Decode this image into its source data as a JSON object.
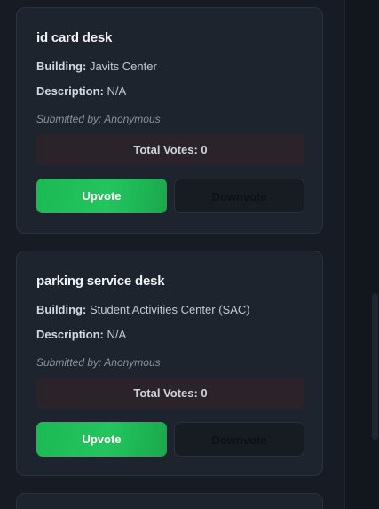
{
  "cards": [
    {
      "title": "id card desk",
      "building_label": "Building:",
      "building": "Javits Center",
      "description_label": "Description:",
      "description": "N/A",
      "submitted": "Submitted by: Anonymous",
      "votes": "Total Votes: 0",
      "upvote_label": "Upvote",
      "downvote_label": "Downvote"
    },
    {
      "title": "parking service desk",
      "building_label": "Building:",
      "building": "Student Activities Center (SAC)",
      "description_label": "Description:",
      "description": "N/A",
      "submitted": "Submitted by: Anonymous",
      "votes": "Total Votes: 0",
      "upvote_label": "Upvote",
      "downvote_label": "Downvote"
    }
  ],
  "colors": {
    "upvote": "#22c55e",
    "votes_bg": "#2b232a",
    "card_bg": "#1e242e"
  }
}
